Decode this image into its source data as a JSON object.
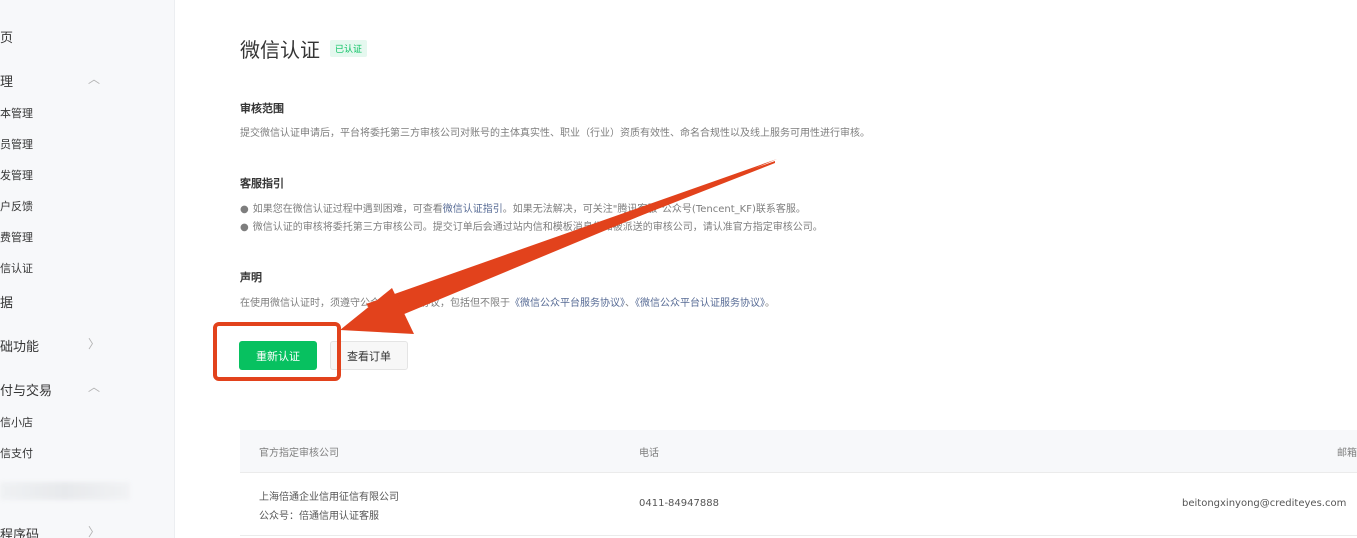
{
  "sidebar": {
    "items": [
      {
        "label": "页",
        "group": true
      },
      {
        "label": "理",
        "group": true,
        "chevron": "chevron-up-icon"
      },
      {
        "label": "本管理"
      },
      {
        "label": "员管理"
      },
      {
        "label": "发管理"
      },
      {
        "label": "户反馈"
      },
      {
        "label": "费管理"
      },
      {
        "label": "信认证"
      },
      {
        "label": "据",
        "group": true
      },
      {
        "label": "础功能",
        "group": true,
        "chevron": "chevron-right-icon"
      },
      {
        "label": "付与交易",
        "group": true,
        "chevron": "chevron-up-icon"
      },
      {
        "label": "信小店"
      },
      {
        "label": "信支付"
      },
      {
        "label": "程序码",
        "group": true,
        "chevron": "chevron-right-icon"
      }
    ]
  },
  "main": {
    "title": "微信认证",
    "badge": "已认证",
    "review_scope": {
      "title": "审核范围",
      "text": "提交微信认证申请后，平台将委托第三方审核公司对账号的主体真实性、职业（行业）资质有效性、命名合规性以及线上服务可用性进行审核。"
    },
    "service_guide": {
      "title": "客服指引",
      "bullet1_text": "如果您在微信认证过程中遇到困难，可查看",
      "bullet1_link": "微信认证指引",
      "bullet1_tail": "。如果无法解决，可关注\"腾讯客服\"公众号(Tencent_KF)联系客服。",
      "bullet2": "微信认证的审核将委托第三方审核公司。提交订单后会通过站内信和模板消息告知被派送的审核公司，请认准官方指定审核公司。"
    },
    "statement": {
      "title": "声明",
      "text": "在使用微信认证时，须遵守公众平台相关协议，包括但不限于",
      "link1": "《微信公众平台服务协议》",
      "sep": "、",
      "link2": "《微信公众平台认证服务协议》",
      "end": "。"
    },
    "buttons": {
      "reauth": "重新认证",
      "view_orders": "查看订单"
    },
    "table": {
      "headers": [
        "官方指定审核公司",
        "电话",
        "邮箱"
      ],
      "rows": [
        {
          "company": "上海倍通企业信用征信有限公司",
          "account": "公众号：倍通信用认证客服",
          "phone": "0411-84947888",
          "email": "beitongxinyong@crediteyes.com"
        }
      ]
    }
  },
  "colors": {
    "accent": "#07c160",
    "annotation": "#e2421c",
    "link": "#576b95"
  }
}
